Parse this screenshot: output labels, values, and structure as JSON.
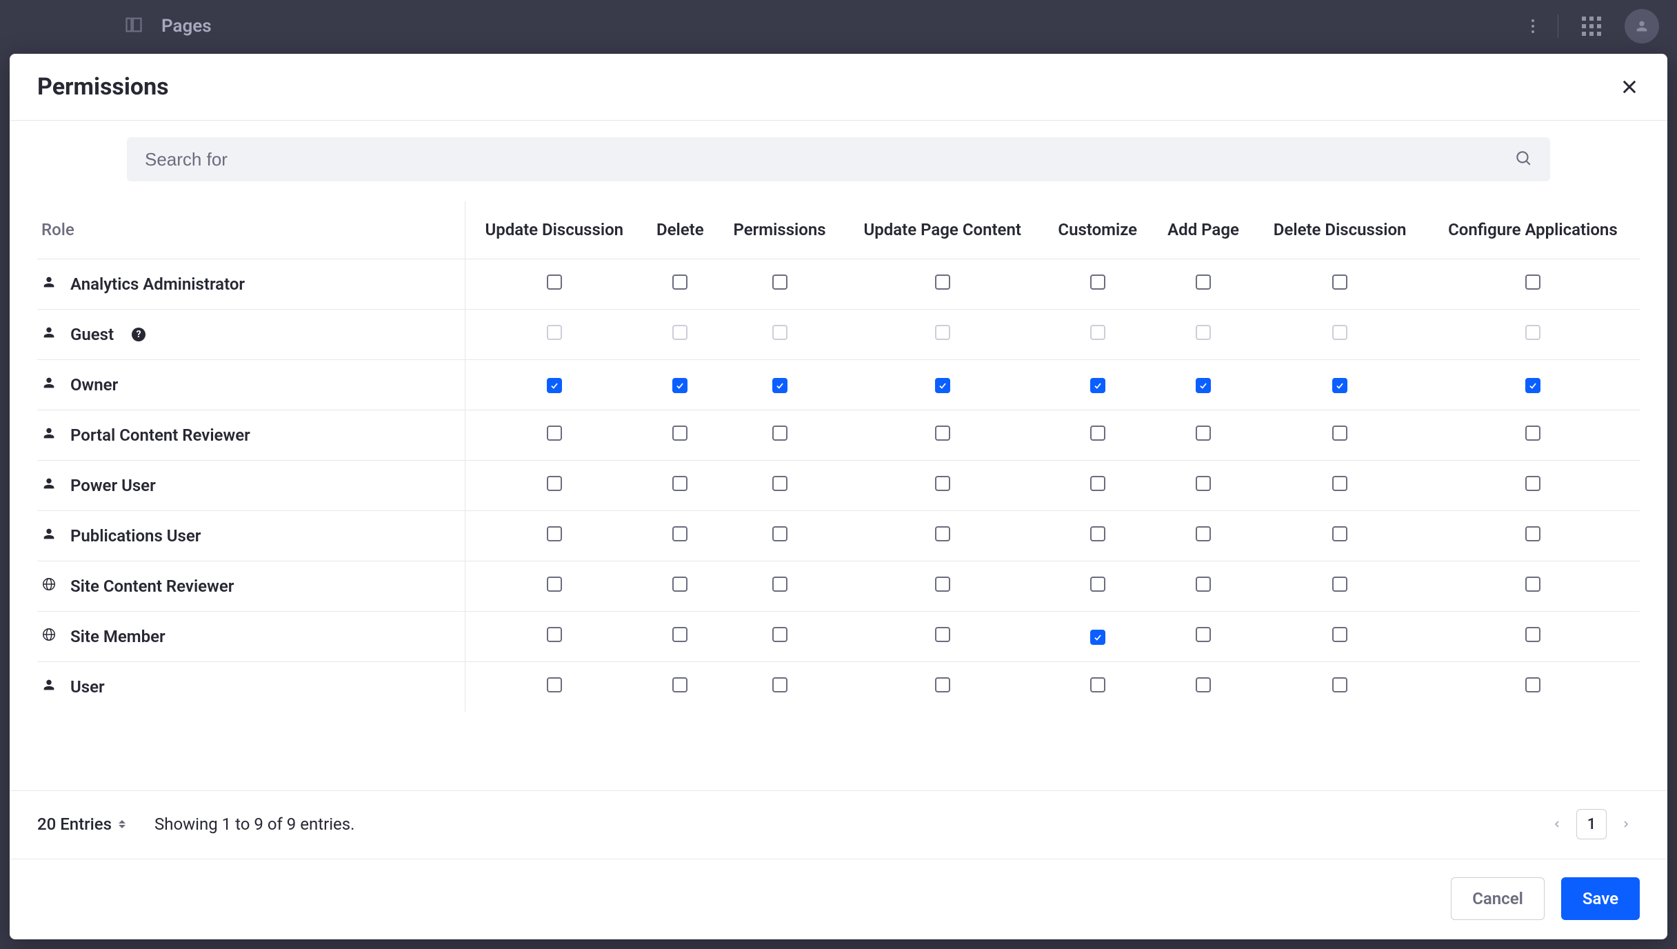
{
  "topbar": {
    "title": "Pages"
  },
  "modal": {
    "title": "Permissions",
    "search_placeholder": "Search for",
    "role_header": "Role",
    "permissions": [
      "Update Discussion",
      "Delete",
      "Permissions",
      "Update Page Content",
      "Customize",
      "Add Page",
      "Delete Discussion",
      "Configure Applications"
    ],
    "roles": [
      {
        "name": "Analytics Administrator",
        "icon": "user",
        "info": false,
        "checks": [
          false,
          false,
          false,
          false,
          false,
          false,
          false,
          false
        ],
        "disabled": false
      },
      {
        "name": "Guest",
        "icon": "user",
        "info": true,
        "checks": [
          false,
          false,
          false,
          false,
          false,
          false,
          false,
          false
        ],
        "disabled": true
      },
      {
        "name": "Owner",
        "icon": "user",
        "info": false,
        "checks": [
          true,
          true,
          true,
          true,
          true,
          true,
          true,
          true
        ],
        "disabled": false
      },
      {
        "name": "Portal Content Reviewer",
        "icon": "user",
        "info": false,
        "checks": [
          false,
          false,
          false,
          false,
          false,
          false,
          false,
          false
        ],
        "disabled": false
      },
      {
        "name": "Power User",
        "icon": "user",
        "info": false,
        "checks": [
          false,
          false,
          false,
          false,
          false,
          false,
          false,
          false
        ],
        "disabled": false
      },
      {
        "name": "Publications User",
        "icon": "user",
        "info": false,
        "checks": [
          false,
          false,
          false,
          false,
          false,
          false,
          false,
          false
        ],
        "disabled": false
      },
      {
        "name": "Site Content Reviewer",
        "icon": "site",
        "info": false,
        "checks": [
          false,
          false,
          false,
          false,
          false,
          false,
          false,
          false
        ],
        "disabled": false
      },
      {
        "name": "Site Member",
        "icon": "site",
        "info": false,
        "checks": [
          false,
          false,
          false,
          false,
          true,
          false,
          false,
          false
        ],
        "disabled": false
      },
      {
        "name": "User",
        "icon": "user",
        "info": false,
        "checks": [
          false,
          false,
          false,
          false,
          false,
          false,
          false,
          false
        ],
        "disabled": false
      }
    ],
    "footer": {
      "entries_label": "20 Entries",
      "showing_text": "Showing 1 to 9 of 9 entries.",
      "current_page": "1",
      "cancel_label": "Cancel",
      "save_label": "Save"
    }
  }
}
